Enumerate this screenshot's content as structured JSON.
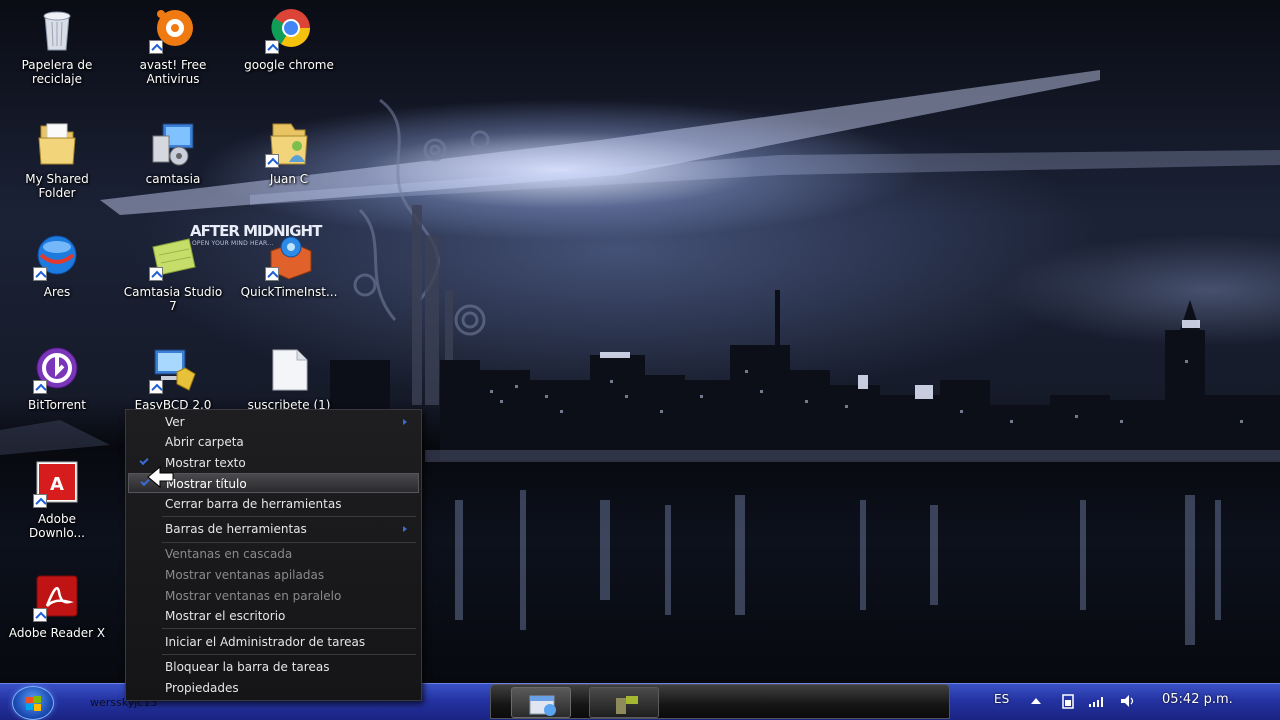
{
  "desktop": {
    "icons": [
      {
        "label": "Papelera de\nreciclaje",
        "icon": "recycle-bin-icon"
      },
      {
        "label": "avast! Free\nAntivirus",
        "icon": "avast-icon"
      },
      {
        "label": "google chrome",
        "icon": "chrome-icon"
      },
      {
        "label": "My Shared\nFolder",
        "icon": "folder-icon"
      },
      {
        "label": "camtasia",
        "icon": "camtasia-installer-icon"
      },
      {
        "label": "Juan C",
        "icon": "user-folder-icon"
      },
      {
        "label": "Ares",
        "icon": "ares-icon"
      },
      {
        "label": "Camtasia Studio\n7",
        "icon": "camtasia-studio-icon"
      },
      {
        "label": "QuickTimeInst...",
        "icon": "quicktime-icon"
      },
      {
        "label": "BitTorrent",
        "icon": "bittorrent-icon"
      },
      {
        "label": "EasyBCD 2.0",
        "icon": "easybcd-icon"
      },
      {
        "label": "suscribete (1)",
        "icon": "document-icon"
      },
      {
        "label": "Adobe\nDownlo...",
        "icon": "adobe-download-icon"
      },
      {
        "label": "Adobe Reader X",
        "icon": "adobe-reader-icon"
      }
    ]
  },
  "wallpaper": {
    "title": "AFTER MIDNIGHT",
    "subtitle": "OPEN YOUR MIND HEAR..."
  },
  "context_menu": {
    "items": [
      {
        "label": "Ver",
        "submenu": true,
        "disabled": false
      },
      {
        "label": "Abrir carpeta",
        "submenu": false,
        "disabled": false
      },
      {
        "label": "Mostrar texto",
        "checked": true,
        "disabled": false
      },
      {
        "label": "Mostrar título",
        "checked": true,
        "highlighted": true,
        "disabled": false
      },
      {
        "label": "Cerrar barra de herramientas",
        "disabled": false
      },
      {
        "label": "Barras de herramientas",
        "submenu": true,
        "disabled": false
      },
      {
        "label": "Ventanas en cascada",
        "disabled": true
      },
      {
        "label": "Mostrar ventanas apiladas",
        "disabled": true
      },
      {
        "label": "Mostrar ventanas en paralelo",
        "disabled": true
      },
      {
        "label": "Mostrar el escritorio",
        "disabled": false
      },
      {
        "label": "Iniciar el Administrador de tareas",
        "disabled": false
      },
      {
        "label": "Bloquear la barra de tareas",
        "disabled": false
      },
      {
        "label": "Propiedades",
        "disabled": false
      }
    ]
  },
  "taskbar": {
    "toolbar_label": "wersskyjc13",
    "language": "ES",
    "clock": "05:42 p.m.",
    "tray_icons": [
      "show-hidden-icons-icon",
      "battery-icon",
      "network-signal-icon",
      "volume-icon"
    ]
  },
  "colors": {
    "taskbar_blue": "#2433a2",
    "menu_bg": "#1a1a1c",
    "check_blue": "#3b6bd8"
  }
}
